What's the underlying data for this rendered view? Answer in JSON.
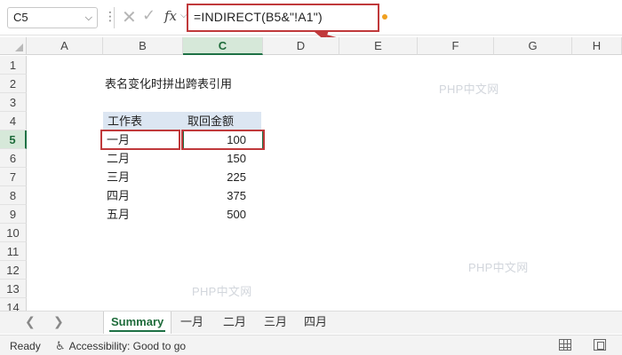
{
  "formula_bar": {
    "name_box": "C5",
    "fx_label": "fx",
    "formula": "=INDIRECT(B5&\"!A1\")"
  },
  "columns": [
    "A",
    "B",
    "C",
    "D",
    "E",
    "F",
    "G",
    "H"
  ],
  "rows": [
    "1",
    "2",
    "3",
    "4",
    "5",
    "6",
    "7",
    "8",
    "9",
    "10",
    "11",
    "12",
    "13",
    "14"
  ],
  "sheet": {
    "title": "表名变化时拼出跨表引用",
    "table_headers": [
      "工作表",
      "取回金额"
    ],
    "table_rows": [
      {
        "sheet_name": "一月",
        "amount": "100"
      },
      {
        "sheet_name": "二月",
        "amount": "150"
      },
      {
        "sheet_name": "三月",
        "amount": "225"
      },
      {
        "sheet_name": "四月",
        "amount": "375"
      },
      {
        "sheet_name": "五月",
        "amount": "500"
      }
    ],
    "watermarks": [
      "PHP中文网",
      "PHP中文网",
      "PHP中文网"
    ]
  },
  "tabs": [
    "Summary",
    "一月",
    "二月",
    "三月",
    "四月"
  ],
  "status": {
    "ready": "Ready",
    "accessibility": "Accessibility: Good to go"
  },
  "colors": {
    "highlight_box": "#c0393b",
    "selection": "#1e7145",
    "table_header_fill": "#dce6f2"
  }
}
